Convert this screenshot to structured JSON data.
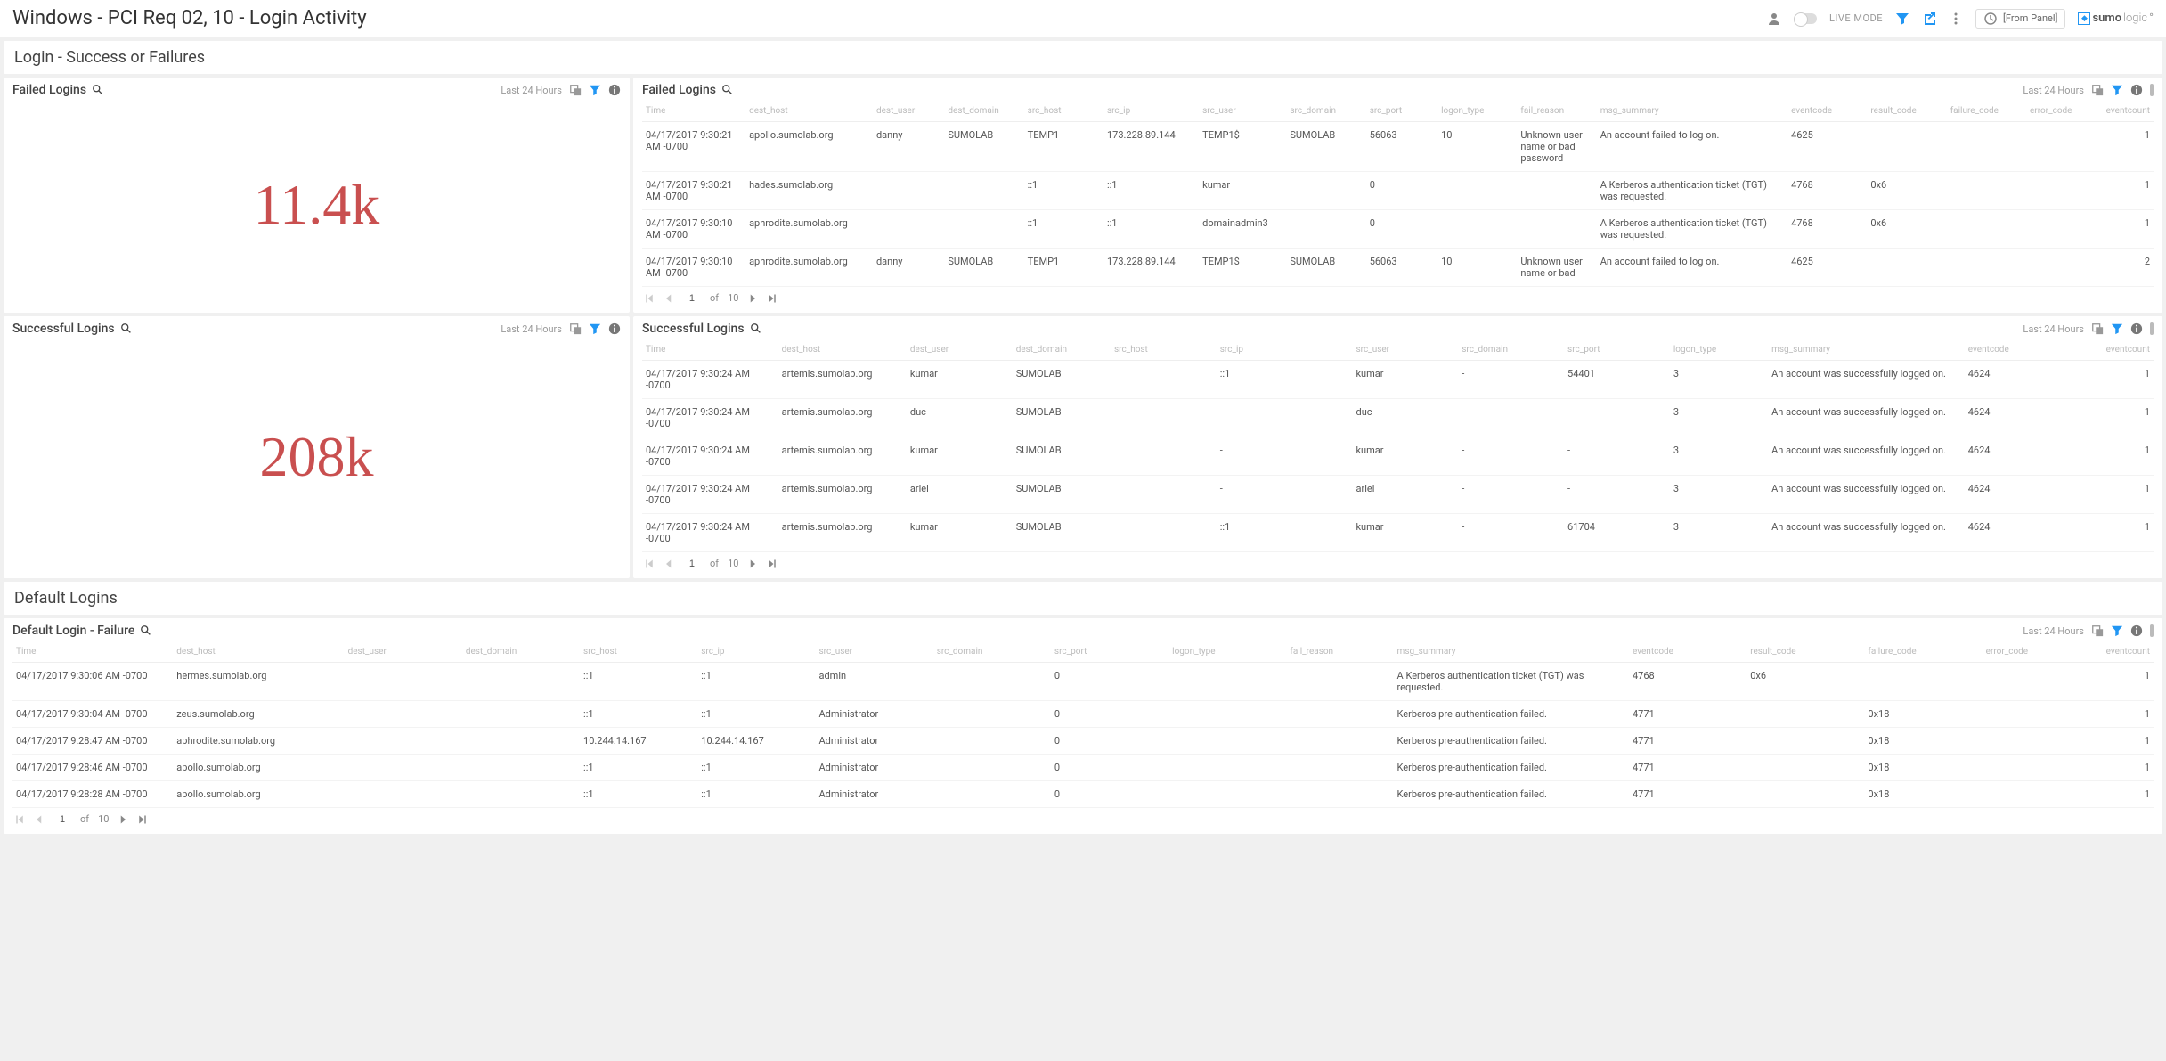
{
  "header": {
    "title": "Windows - PCI Req 02, 10 - Login Activity",
    "live_mode_label": "LIVE MODE",
    "time_source": "[From Panel]",
    "brand_bold": "sumo",
    "brand_light": "logic"
  },
  "section_login": {
    "title": "Login - Success or Failures"
  },
  "section_default": {
    "title": "Default Logins"
  },
  "panel_failed_count": {
    "title": "Failed Logins",
    "timerange": "Last 24 Hours",
    "value": "11.4k"
  },
  "panel_success_count": {
    "title": "Successful Logins",
    "timerange": "Last 24 Hours",
    "value": "208k"
  },
  "failed_table": {
    "title": "Failed Logins",
    "timerange": "Last 24 Hours",
    "columns": [
      "Time",
      "dest_host",
      "dest_user",
      "dest_domain",
      "src_host",
      "src_ip",
      "src_user",
      "src_domain",
      "src_port",
      "logon_type",
      "fail_reason",
      "msg_summary",
      "eventcode",
      "result_code",
      "failure_code",
      "error_code",
      "eventcount"
    ],
    "rows": [
      {
        "time": "04/17/2017 9:30:21 AM -0700",
        "dest_host": "apollo.sumolab.org",
        "dest_user": "danny",
        "dest_domain": "SUMOLAB",
        "src_host": "TEMP1",
        "src_ip": "173.228.89.144",
        "src_user": "TEMP1$",
        "src_domain": "SUMOLAB",
        "src_port": "56063",
        "logon_type": "10",
        "fail_reason": "Unknown user name or bad password",
        "msg_summary": "An account failed to log on.",
        "eventcode": "4625",
        "result_code": "",
        "failure_code": "",
        "error_code": "",
        "eventcount": "1"
      },
      {
        "time": "04/17/2017 9:30:21 AM -0700",
        "dest_host": "hades.sumolab.org",
        "dest_user": "",
        "dest_domain": "",
        "src_host": "::1",
        "src_ip": "::1",
        "src_user": "kumar",
        "src_domain": "",
        "src_port": "0",
        "logon_type": "",
        "fail_reason": "",
        "msg_summary": "A Kerberos authentication ticket (TGT) was requested.",
        "eventcode": "4768",
        "result_code": "0x6",
        "failure_code": "",
        "error_code": "",
        "eventcount": "1"
      },
      {
        "time": "04/17/2017 9:30:10 AM -0700",
        "dest_host": "aphrodite.sumolab.org",
        "dest_user": "",
        "dest_domain": "",
        "src_host": "::1",
        "src_ip": "::1",
        "src_user": "domainadmin3",
        "src_domain": "",
        "src_port": "0",
        "logon_type": "",
        "fail_reason": "",
        "msg_summary": "A Kerberos authentication ticket (TGT) was requested.",
        "eventcode": "4768",
        "result_code": "0x6",
        "failure_code": "",
        "error_code": "",
        "eventcount": "1"
      },
      {
        "time": "04/17/2017 9:30:10 AM -0700",
        "dest_host": "aphrodite.sumolab.org",
        "dest_user": "danny",
        "dest_domain": "SUMOLAB",
        "src_host": "TEMP1",
        "src_ip": "173.228.89.144",
        "src_user": "TEMP1$",
        "src_domain": "SUMOLAB",
        "src_port": "56063",
        "logon_type": "10",
        "fail_reason": "Unknown user name or bad",
        "msg_summary": "An account failed to log on.",
        "eventcode": "4625",
        "result_code": "",
        "failure_code": "",
        "error_code": "",
        "eventcount": "2"
      }
    ],
    "pager": {
      "page": "1",
      "of": "of",
      "total": "10"
    }
  },
  "success_table": {
    "title": "Successful Logins",
    "timerange": "Last 24 Hours",
    "columns": [
      "Time",
      "dest_host",
      "dest_user",
      "dest_domain",
      "src_host",
      "src_ip",
      "src_user",
      "src_domain",
      "src_port",
      "logon_type",
      "msg_summary",
      "eventcode",
      "eventcount"
    ],
    "rows": [
      {
        "time": "04/17/2017 9:30:24 AM -0700",
        "dest_host": "artemis.sumolab.org",
        "dest_user": "kumar",
        "dest_domain": "SUMOLAB",
        "src_host": "",
        "src_ip": "::1",
        "src_user": "kumar",
        "src_domain": "-",
        "src_port": "54401",
        "logon_type": "3",
        "msg_summary": "An account was successfully logged on.",
        "eventcode": "4624",
        "eventcount": "1"
      },
      {
        "time": "04/17/2017 9:30:24 AM -0700",
        "dest_host": "artemis.sumolab.org",
        "dest_user": "duc",
        "dest_domain": "SUMOLAB",
        "src_host": "",
        "src_ip": "-",
        "src_user": "duc",
        "src_domain": "-",
        "src_port": "-",
        "logon_type": "3",
        "msg_summary": "An account was successfully logged on.",
        "eventcode": "4624",
        "eventcount": "1"
      },
      {
        "time": "04/17/2017 9:30:24 AM -0700",
        "dest_host": "artemis.sumolab.org",
        "dest_user": "kumar",
        "dest_domain": "SUMOLAB",
        "src_host": "",
        "src_ip": "-",
        "src_user": "kumar",
        "src_domain": "-",
        "src_port": "-",
        "logon_type": "3",
        "msg_summary": "An account was successfully logged on.",
        "eventcode": "4624",
        "eventcount": "1"
      },
      {
        "time": "04/17/2017 9:30:24 AM -0700",
        "dest_host": "artemis.sumolab.org",
        "dest_user": "ariel",
        "dest_domain": "SUMOLAB",
        "src_host": "",
        "src_ip": "-",
        "src_user": "ariel",
        "src_domain": "-",
        "src_port": "-",
        "logon_type": "3",
        "msg_summary": "An account was successfully logged on.",
        "eventcode": "4624",
        "eventcount": "1"
      },
      {
        "time": "04/17/2017 9:30:24 AM -0700",
        "dest_host": "artemis.sumolab.org",
        "dest_user": "kumar",
        "dest_domain": "SUMOLAB",
        "src_host": "",
        "src_ip": "::1",
        "src_user": "kumar",
        "src_domain": "-",
        "src_port": "61704",
        "logon_type": "3",
        "msg_summary": "An account was successfully logged on.",
        "eventcode": "4624",
        "eventcount": "1"
      }
    ],
    "pager": {
      "page": "1",
      "of": "of",
      "total": "10"
    }
  },
  "default_table": {
    "title": "Default Login - Failure",
    "timerange": "Last 24 Hours",
    "columns": [
      "Time",
      "dest_host",
      "dest_user",
      "dest_domain",
      "src_host",
      "src_ip",
      "src_user",
      "src_domain",
      "src_port",
      "logon_type",
      "fail_reason",
      "msg_summary",
      "eventcode",
      "result_code",
      "failure_code",
      "error_code",
      "eventcount"
    ],
    "rows": [
      {
        "time": "04/17/2017 9:30:06 AM -0700",
        "dest_host": "hermes.sumolab.org",
        "dest_user": "",
        "dest_domain": "",
        "src_host": "::1",
        "src_ip": "::1",
        "src_user": "admin",
        "src_domain": "",
        "src_port": "0",
        "logon_type": "",
        "fail_reason": "",
        "msg_summary": "A Kerberos authentication ticket (TGT) was requested.",
        "eventcode": "4768",
        "result_code": "0x6",
        "failure_code": "",
        "error_code": "",
        "eventcount": "1"
      },
      {
        "time": "04/17/2017 9:30:04 AM -0700",
        "dest_host": "zeus.sumolab.org",
        "dest_user": "",
        "dest_domain": "",
        "src_host": "::1",
        "src_ip": "::1",
        "src_user": "Administrator",
        "src_domain": "",
        "src_port": "0",
        "logon_type": "",
        "fail_reason": "",
        "msg_summary": "Kerberos pre-authentication failed.",
        "eventcode": "4771",
        "result_code": "",
        "failure_code": "0x18",
        "error_code": "",
        "eventcount": "1"
      },
      {
        "time": "04/17/2017 9:28:47 AM -0700",
        "dest_host": "aphrodite.sumolab.org",
        "dest_user": "",
        "dest_domain": "",
        "src_host": "10.244.14.167",
        "src_ip": "10.244.14.167",
        "src_user": "Administrator",
        "src_domain": "",
        "src_port": "0",
        "logon_type": "",
        "fail_reason": "",
        "msg_summary": "Kerberos pre-authentication failed.",
        "eventcode": "4771",
        "result_code": "",
        "failure_code": "0x18",
        "error_code": "",
        "eventcount": "1"
      },
      {
        "time": "04/17/2017 9:28:46 AM -0700",
        "dest_host": "apollo.sumolab.org",
        "dest_user": "",
        "dest_domain": "",
        "src_host": "::1",
        "src_ip": "::1",
        "src_user": "Administrator",
        "src_domain": "",
        "src_port": "0",
        "logon_type": "",
        "fail_reason": "",
        "msg_summary": "Kerberos pre-authentication failed.",
        "eventcode": "4771",
        "result_code": "",
        "failure_code": "0x18",
        "error_code": "",
        "eventcount": "1"
      },
      {
        "time": "04/17/2017 9:28:28 AM -0700",
        "dest_host": "apollo.sumolab.org",
        "dest_user": "",
        "dest_domain": "",
        "src_host": "::1",
        "src_ip": "::1",
        "src_user": "Administrator",
        "src_domain": "",
        "src_port": "0",
        "logon_type": "",
        "fail_reason": "",
        "msg_summary": "Kerberos pre-authentication failed.",
        "eventcode": "4771",
        "result_code": "",
        "failure_code": "0x18",
        "error_code": "",
        "eventcount": "1"
      }
    ],
    "pager": {
      "page": "1",
      "of": "of",
      "total": "10"
    }
  }
}
